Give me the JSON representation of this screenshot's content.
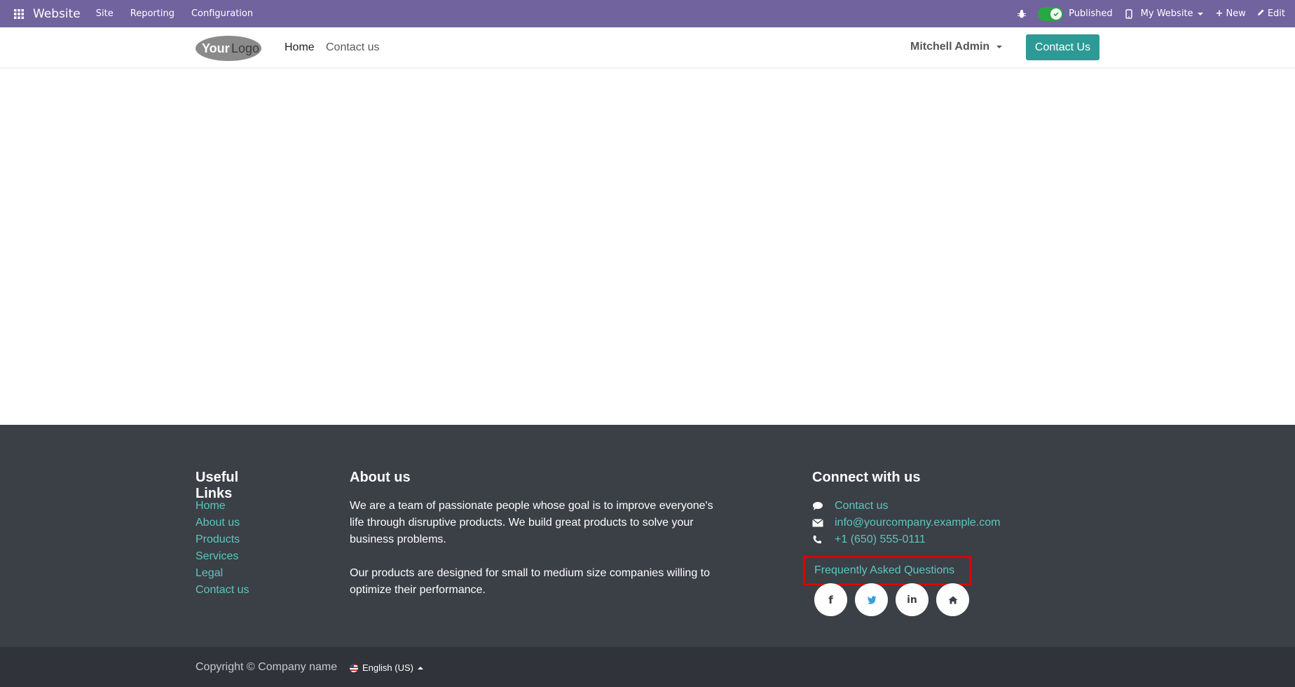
{
  "admin_bar": {
    "brand": "Website",
    "menu": [
      "Site",
      "Reporting",
      "Configuration"
    ],
    "published_label": "Published",
    "my_website_label": "My Website",
    "new_label": "New",
    "edit_label": "Edit",
    "bar_color": "#71639e"
  },
  "header": {
    "nav": [
      "Home",
      "Contact us"
    ],
    "user_name": "Mitchell Admin",
    "contact_button": "Contact Us",
    "accent_color": "#2d9a96"
  },
  "footer": {
    "useful_links": {
      "title": "Useful Links",
      "items": [
        "Home",
        "About us",
        "Products",
        "Services",
        "Legal",
        "Contact us"
      ]
    },
    "about": {
      "title": "About us",
      "p1": "We are a team of passionate people whose goal is to improve everyone's life through disruptive products. We build great products to solve your business problems.",
      "p2": "Our products are designed for small to medium size companies willing to optimize their performance."
    },
    "connect": {
      "title": "Connect with us",
      "contact": "Contact us",
      "email": "info@yourcompany.example.com",
      "phone": "+1 (650) 555-0111",
      "faq": "Frequently Asked Questions",
      "socials": [
        "facebook-icon",
        "twitter-icon",
        "linkedin-icon",
        "home-icon"
      ]
    }
  },
  "copyright": {
    "text": "Copyright © Company name",
    "language": "English (US)"
  }
}
